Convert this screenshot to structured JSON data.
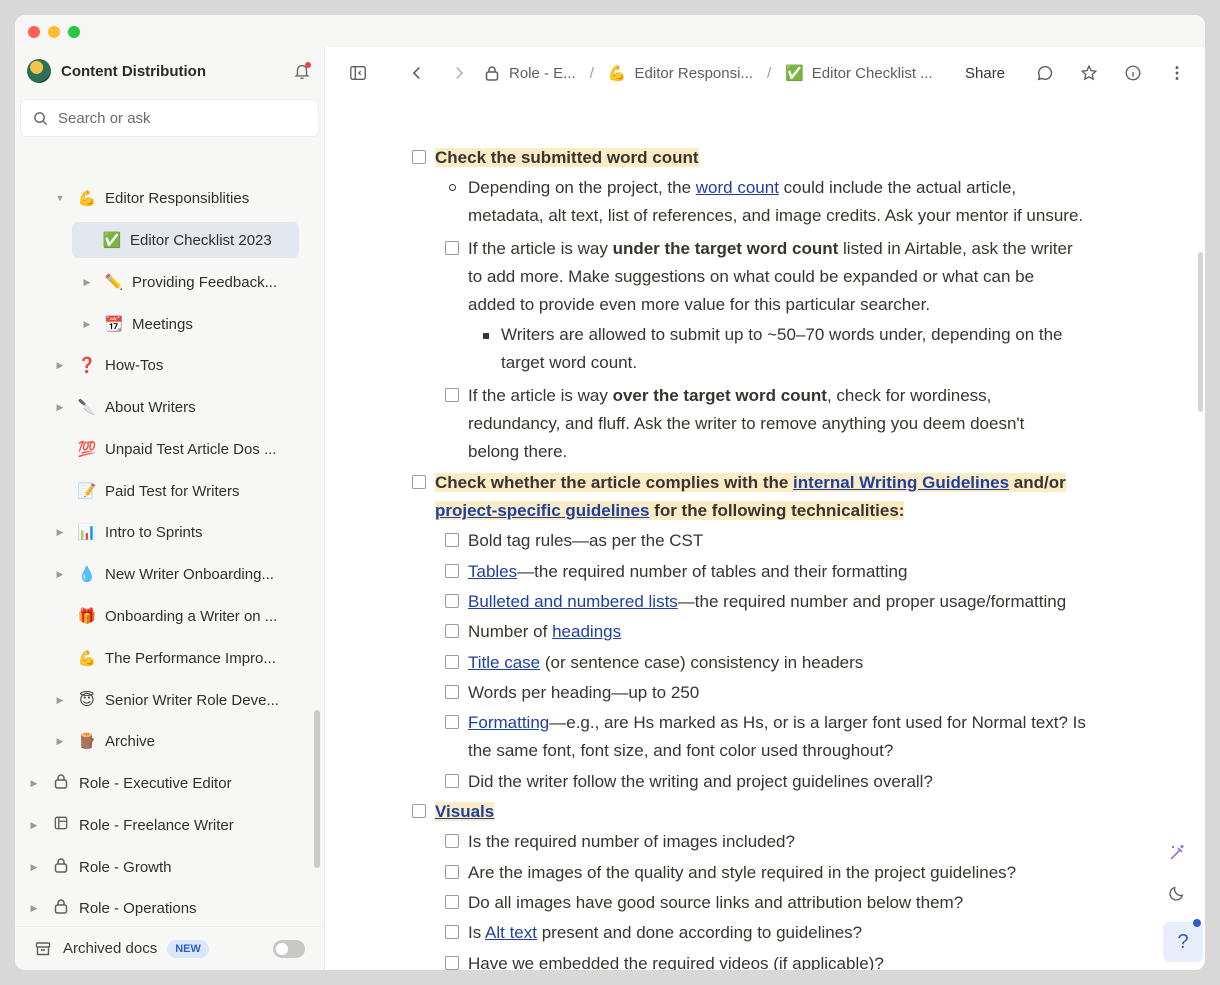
{
  "workspace": {
    "name": "Content Distribution"
  },
  "search": {
    "placeholder": "Search or ask"
  },
  "sidebar": {
    "items": [
      {
        "label": "Editor Responsiblities",
        "emoji": "💪"
      },
      {
        "label": "Editor Checklist 2023",
        "emoji": "✅"
      },
      {
        "label": "Providing Feedback...",
        "emoji": "✏️"
      },
      {
        "label": "Meetings",
        "emoji": "📆"
      },
      {
        "label": "How-Tos",
        "emoji": "❓"
      },
      {
        "label": "About Writers",
        "emoji": "🔪"
      },
      {
        "label": "Unpaid Test Article Dos ...",
        "emoji": "💯"
      },
      {
        "label": "Paid Test for Writers",
        "emoji": "📝"
      },
      {
        "label": "Intro to Sprints",
        "emoji": "📊"
      },
      {
        "label": "New Writer Onboarding...",
        "emoji": "💧"
      },
      {
        "label": "Onboarding a Writer on ...",
        "emoji": "🎁"
      },
      {
        "label": "The Performance Impro...",
        "emoji": "💪"
      },
      {
        "label": "Senior Writer Role Deve...",
        "emoji": "😇"
      },
      {
        "label": "Archive",
        "emoji": "🪵"
      },
      {
        "label": "Role - Executive Editor"
      },
      {
        "label": "Role - Freelance Writer"
      },
      {
        "label": "Role - Growth"
      },
      {
        "label": "Role - Operations"
      }
    ],
    "archived_label": "Archived docs",
    "archived_badge": "NEW"
  },
  "topbar": {
    "crumb1": "Role - E...",
    "crumb2": "Editor Responsi...",
    "crumb2_emoji": "💪",
    "crumb3": "Editor Checklist ...",
    "crumb3_emoji": "✅",
    "sep": "/",
    "share_label": "Share"
  },
  "doc": {
    "h1": "Check the submitted word count",
    "b1_pre": "Depending on the project, the ",
    "b1_link": "word count",
    "b1_post": " could include the actual article,",
    "b1_line2": "metadata, alt text, list of references, and image credits. Ask your mentor if unsure.",
    "c1_pre": "If the article is way ",
    "c1_bold": "under the target word count",
    "c1_post": " listed in Airtable, ask the writer",
    "c1_line2": "to add more. Make suggestions on what could be expanded or what can be",
    "c1_line3": "added to provide even more value for this particular searcher.",
    "s1_line1": "Writers are allowed to submit up to ~50–70 words under, depending on the",
    "s1_line2": "target word count.",
    "c2_pre": "If the article is way ",
    "c2_bold": "over the target word count",
    "c2_post": ", check for wordiness,",
    "c2_line2": "redundancy, and fluff. Ask the writer to remove anything you deem doesn't",
    "c2_line3": "belong there.",
    "h2_pre": "Check whether the article complies with the ",
    "h2_link1": "internal Writing Guidelines",
    "h2_mid": " and/or",
    "h2_link2": "project-specific guidelines",
    "h2_post": " for the following technicalities:",
    "t1": "Bold tag rules—as per the CST",
    "t2_link": "Tables",
    "t2_post": "—the required number of tables and their formatting",
    "t3_link": "Bulleted and numbered lists",
    "t3_post": "—the required number and proper usage/formatting",
    "t4_pre": "Number of ",
    "t4_link": "headings",
    "t5_link": "Title case",
    "t5_post": " (or sentence case) consistency in headers",
    "t6": "Words per heading—up to 250",
    "t7_link": "Formatting",
    "t7_post": "—e.g., are Hs marked as Hs, or is a larger font used for Normal text? Is",
    "t7_line2": "the same font, font size, and font color used throughout?",
    "t8": "Did the writer follow the writing and project guidelines overall?",
    "h3_link": "Visuals",
    "v1": "Is the required number of images included?",
    "v2": "Are the images of the quality and style required in the project guidelines?",
    "v3": "Do all images have good source links and attribution below them?",
    "v4_pre": "Is ",
    "v4_link": "Alt text",
    "v4_post": " present and done according to guidelines?",
    "v5": "Have we embedded the required videos (if applicable)?"
  },
  "help_label": "?"
}
